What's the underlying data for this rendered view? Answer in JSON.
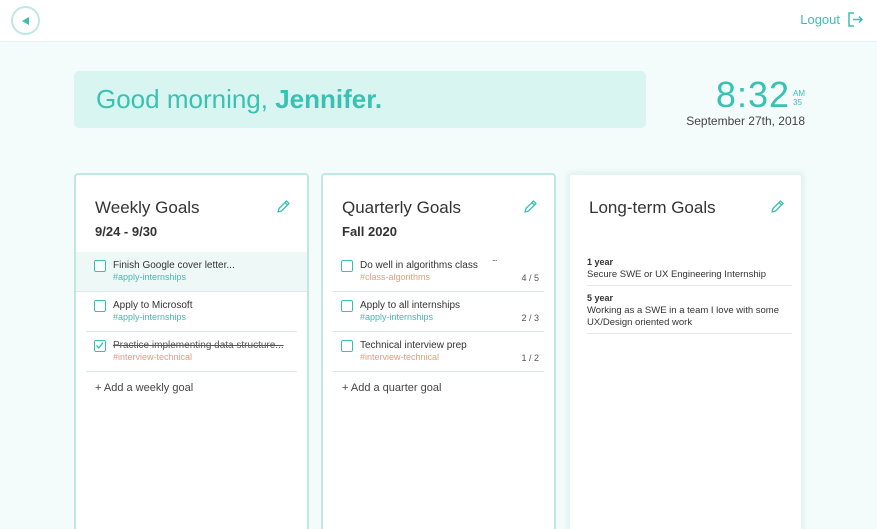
{
  "header": {
    "logout_label": "Logout"
  },
  "greeting": {
    "prefix": "Good morning, ",
    "name": "Jennifer."
  },
  "clock": {
    "time": "8:32",
    "ampm": "AM",
    "seconds": "35",
    "date": "September 27th, 2018"
  },
  "weekly": {
    "title": "Weekly Goals",
    "subtitle": "9/24 - 9/30",
    "goals": [
      {
        "title": "Finish Google cover letter...",
        "tag": "#apply-internships",
        "checked": false
      },
      {
        "title": "Apply to Microsoft",
        "tag": "#apply-internships",
        "checked": false
      },
      {
        "title": "Practice implementing data structure...",
        "tag": "#interview-technical",
        "checked": true
      }
    ],
    "add_label": "+ Add a weekly goal"
  },
  "quarterly": {
    "title": "Quarterly Goals",
    "subtitle": "Fall 2020",
    "goals": [
      {
        "title": "Do well in algorithms class",
        "dots": "...",
        "tag": "#class-algorithms",
        "count": "4 / 5"
      },
      {
        "title": "Apply to all internships",
        "tag": "#apply-internships",
        "count": "2 / 3"
      },
      {
        "title": "Technical interview prep",
        "tag": "#interview-technical",
        "count": "1 / 2"
      }
    ],
    "add_label": "+ Add a quarter goal"
  },
  "longterm": {
    "title": "Long-term Goals",
    "items": [
      {
        "period": "1 year",
        "text": "Secure SWE or UX Engineering Internship"
      },
      {
        "period": "5 year",
        "text": "Working as a SWE in a team I love with some UX/Design oriented work"
      }
    ]
  },
  "colors": {
    "accent": "#3bbfb1",
    "greeting_bg": "#d9f5f1",
    "orange_tag": "#f0997a",
    "page_bg": "#f3fcfb"
  },
  "icons": [
    "back-arrow-icon",
    "logout-icon",
    "pencil-icon",
    "checkbox-icon",
    "checkmark-icon"
  ]
}
